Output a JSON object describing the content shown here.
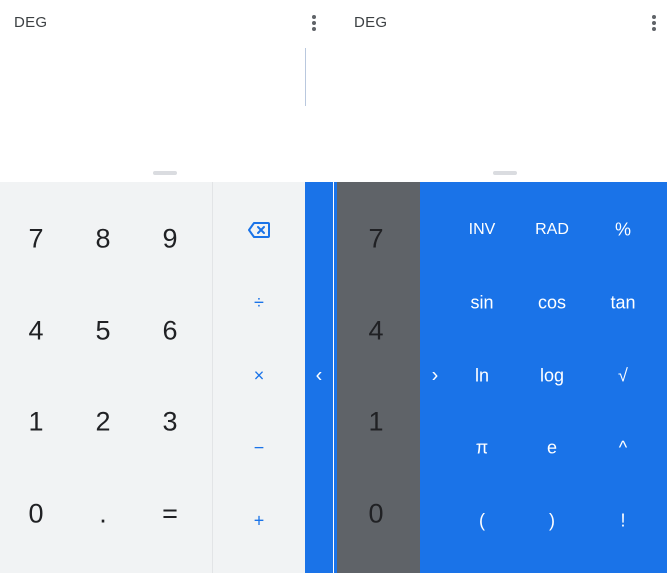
{
  "left_pane": {
    "mode": "DEG",
    "numpad": [
      "7",
      "8",
      "9",
      "4",
      "5",
      "6",
      "1",
      "2",
      "3",
      "0",
      ".",
      "="
    ],
    "operators": {
      "backspace_icon": "backspace-icon",
      "divide": "÷",
      "multiply": "×",
      "subtract": "−",
      "add": "+"
    },
    "expand_arrow": "‹"
  },
  "right_pane": {
    "mode": "DEG",
    "partial_numbers": [
      "7",
      "4",
      "1",
      "0"
    ],
    "collapse_arrow": "›",
    "functions": [
      "INV",
      "RAD",
      "%",
      "sin",
      "cos",
      "tan",
      "ln",
      "log",
      "√",
      "π",
      "e",
      "^",
      "(",
      ")",
      "!"
    ]
  },
  "colors": {
    "accent": "#1a73e8",
    "keypad_bg": "#f1f3f4",
    "gray_panel": "#5f6368",
    "text": "#202124"
  }
}
